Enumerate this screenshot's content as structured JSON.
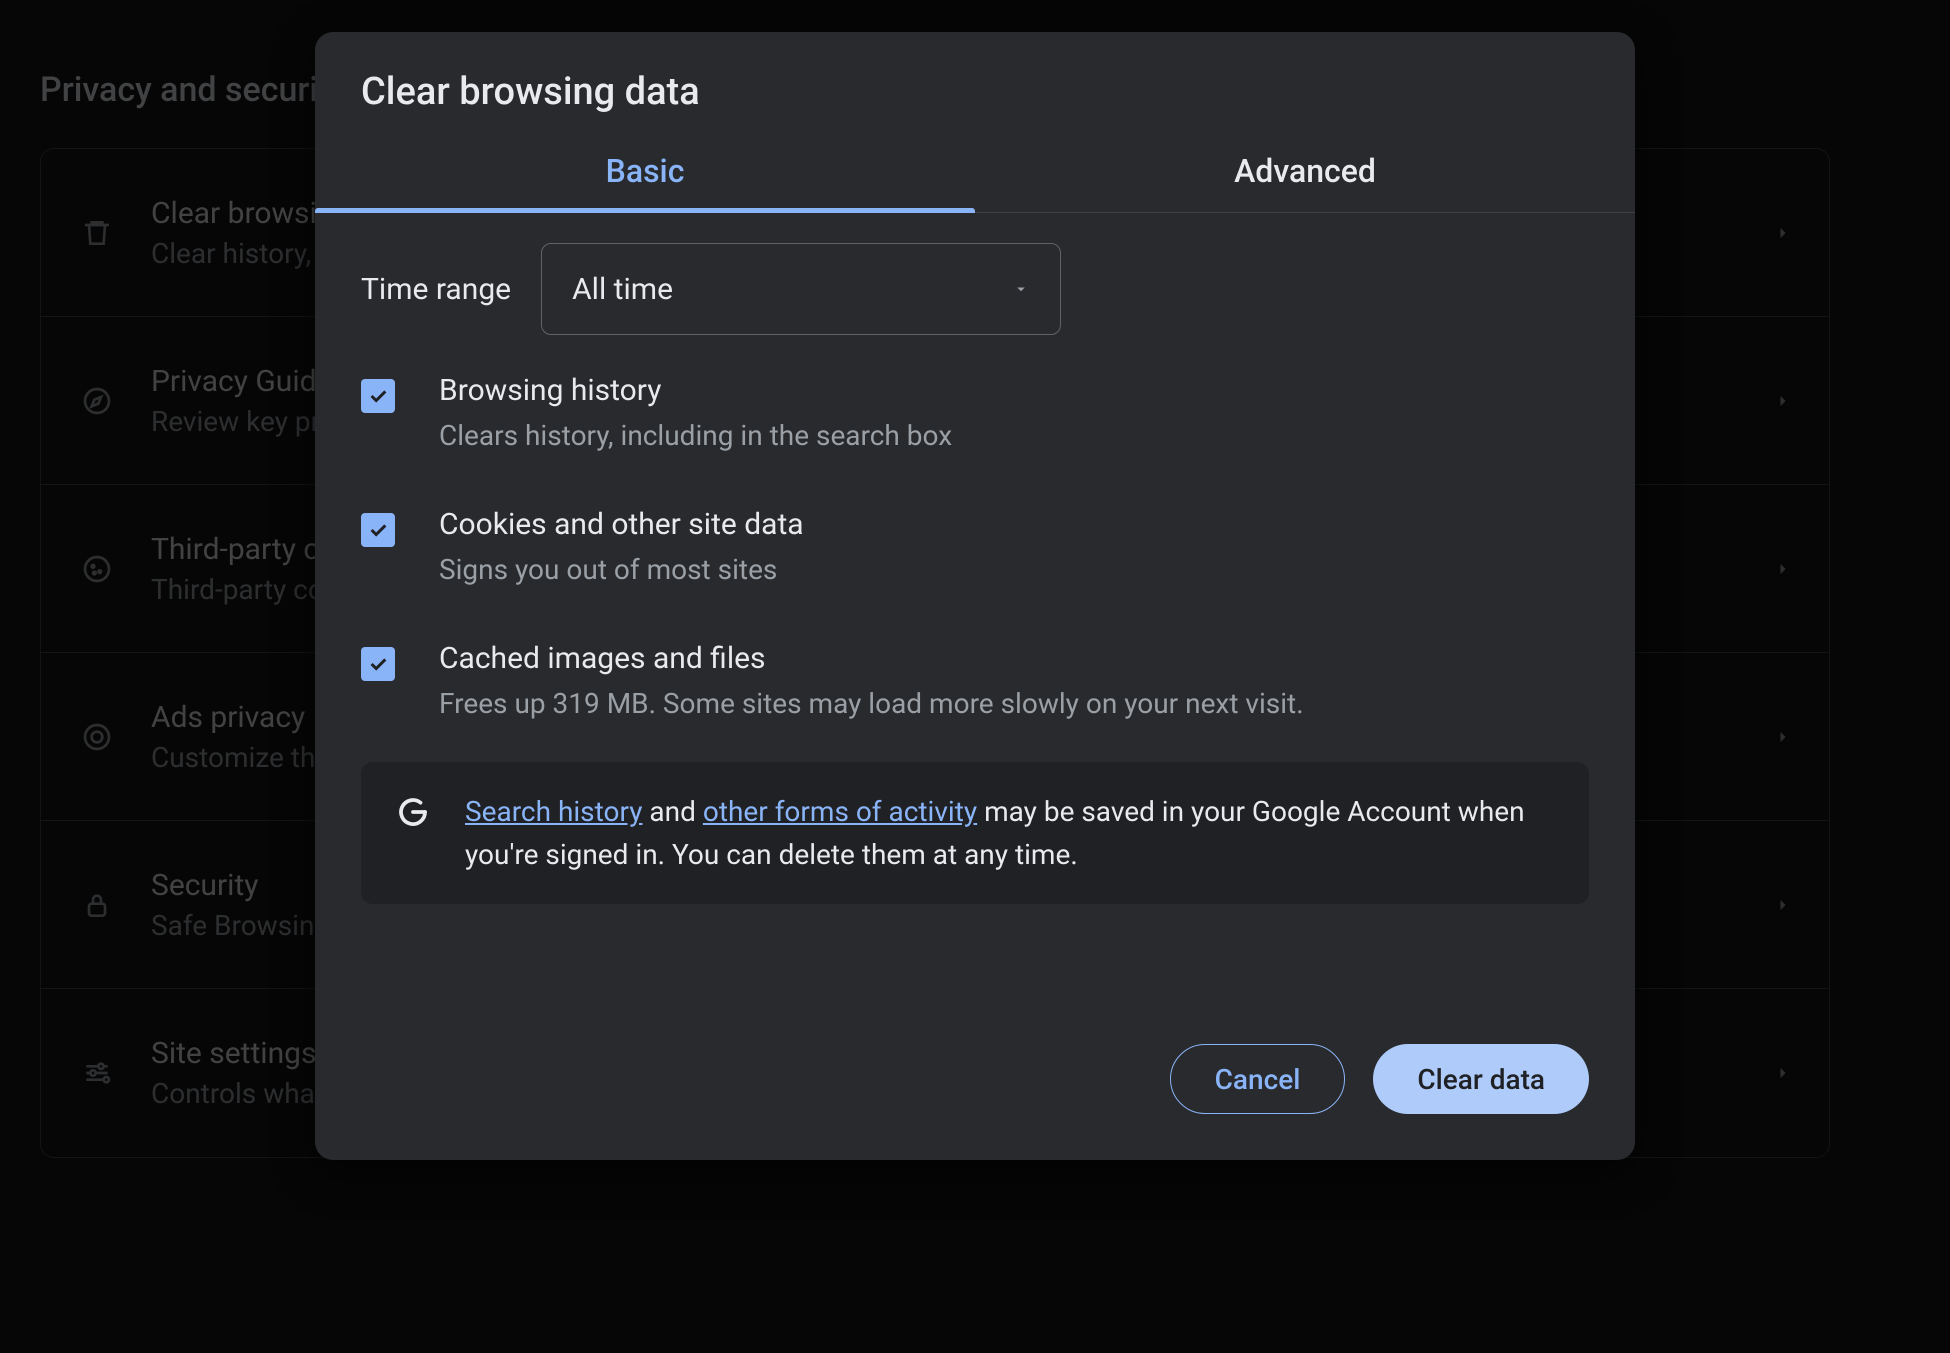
{
  "bg": {
    "heading": "Privacy and security",
    "rows": [
      {
        "icon": "trash",
        "title": "Clear browsing data",
        "sub": "Clear history, cookies, cache, and more"
      },
      {
        "icon": "compass",
        "title": "Privacy Guide",
        "sub": "Review key privacy and security controls"
      },
      {
        "icon": "cookie",
        "title": "Third-party cookies",
        "sub": "Third-party cookies are blocked in Incognito mode"
      },
      {
        "icon": "target",
        "title": "Ads privacy",
        "sub": "Customize the info used by sites to show you ads"
      },
      {
        "icon": "lock",
        "title": "Security",
        "sub": "Safe Browsing (protection from dangerous sites) and other security settings"
      },
      {
        "icon": "sliders",
        "title": "Site settings",
        "sub": "Controls what information sites can use and show"
      }
    ]
  },
  "dialog": {
    "title": "Clear browsing data",
    "tabs": {
      "basic": "Basic",
      "advanced": "Advanced",
      "active": "basic"
    },
    "time_range": {
      "label": "Time range",
      "value": "All time"
    },
    "options": [
      {
        "checked": true,
        "title": "Browsing history",
        "sub": "Clears history, including in the search box"
      },
      {
        "checked": true,
        "title": "Cookies and other site data",
        "sub": "Signs you out of most sites"
      },
      {
        "checked": true,
        "title": "Cached images and files",
        "sub": "Frees up 319 MB. Some sites may load more slowly on your next visit."
      }
    ],
    "info": {
      "link1": "Search history",
      "mid1": " and ",
      "link2": "other forms of activity",
      "rest": " may be saved in your Google Account when you're signed in. You can delete them at any time."
    },
    "buttons": {
      "cancel": "Cancel",
      "confirm": "Clear data"
    }
  }
}
